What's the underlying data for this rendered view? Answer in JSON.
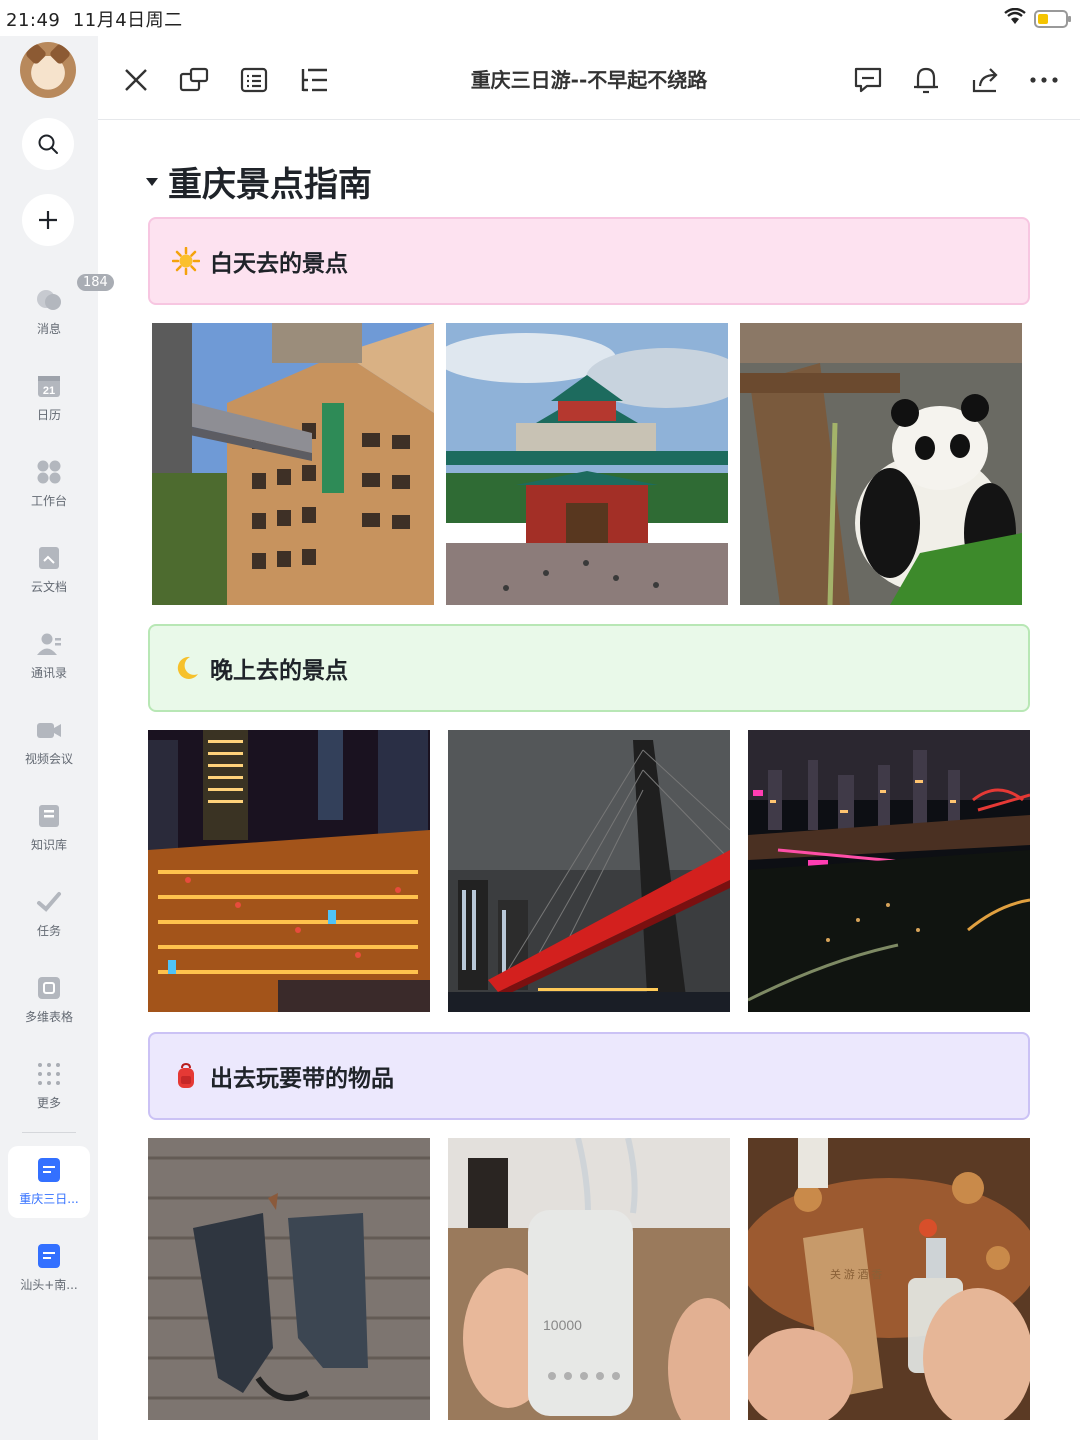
{
  "status_bar": {
    "time": "21:49",
    "date": "11月4日周二"
  },
  "sidebar": {
    "items": [
      {
        "label": "消息",
        "badge": "184"
      },
      {
        "label": "日历",
        "icon_text": "21"
      },
      {
        "label": "工作台"
      },
      {
        "label": "云文档"
      },
      {
        "label": "通讯录"
      },
      {
        "label": "视频会议"
      },
      {
        "label": "知识库"
      },
      {
        "label": "任务"
      },
      {
        "label": "多维表格"
      },
      {
        "label": "更多"
      }
    ],
    "open_docs": [
      {
        "label": "重庆三日...",
        "active": true
      },
      {
        "label": "汕头+南...",
        "active": false
      }
    ]
  },
  "toolbar": {
    "title": "重庆三日游--不早起不绕路"
  },
  "doc": {
    "heading": "重庆景点指南",
    "sections": [
      {
        "label": "白天去的景点",
        "emoji": "sun",
        "bg": "#fde2f0",
        "border": "#f7c6e1",
        "photos": [
          "building-monorail-photo",
          "great-hall-photo",
          "panda-photo"
        ]
      },
      {
        "label": "晚上去的景点",
        "emoji": "crescent-moon",
        "bg": "#e9f9e9",
        "border": "#b8e7b5",
        "photos": [
          "hongyadong-night-photo",
          "bridge-night-photo",
          "city-skyline-night-photo"
        ]
      },
      {
        "label": "出去玩要带的物品",
        "emoji": "backpack",
        "bg": "#ece8fd",
        "border": "#cbc2f5",
        "photos": [
          "umbrella-photo",
          "power-bank-photo",
          "perfume-photo"
        ]
      }
    ],
    "power_bank_text": "10000",
    "perfume_box_text": "关 游 酒 香"
  }
}
